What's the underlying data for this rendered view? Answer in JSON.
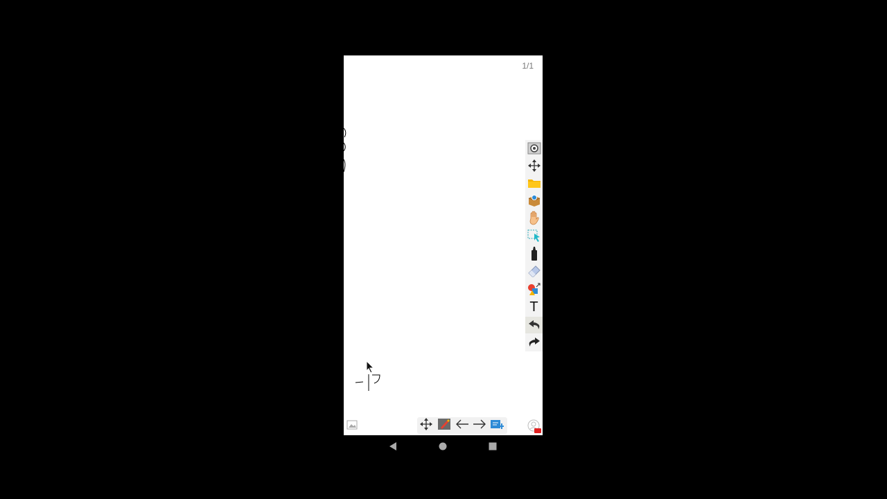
{
  "app": {
    "page_counter": "1/1"
  },
  "toolbar": {
    "items": [
      {
        "name": "settings",
        "icon": "gear-icon"
      },
      {
        "name": "move",
        "icon": "move-arrows-icon"
      },
      {
        "name": "open-folder",
        "icon": "folder-icon"
      },
      {
        "name": "insert-object",
        "icon": "package-icon"
      },
      {
        "name": "pan-hand",
        "icon": "hand-icon"
      },
      {
        "name": "select",
        "icon": "select-cursor-icon"
      },
      {
        "name": "pen",
        "icon": "marker-pen-icon"
      },
      {
        "name": "eraser",
        "icon": "eraser-icon"
      },
      {
        "name": "shapes",
        "icon": "shapes-icon"
      },
      {
        "name": "text",
        "icon": "text-icon",
        "label": "T"
      },
      {
        "name": "undo",
        "icon": "undo-icon"
      },
      {
        "name": "redo",
        "icon": "redo-icon"
      }
    ]
  },
  "bottom_bar": {
    "left_icon": "image-icon",
    "center": [
      "move-arrows-icon",
      "screen-draw-icon",
      "arrow-left-icon",
      "arrow-right-icon",
      "add-page-icon"
    ],
    "right_icon": "record-icon",
    "record_badge": "REC"
  },
  "android_nav": [
    "back-icon",
    "home-icon",
    "recents-icon"
  ],
  "colors": {
    "background": "#000000",
    "canvas": "#ffffff",
    "toolbar_bg": "#f3f3f3",
    "folder": "#f5b400",
    "accent_blue": "#2c8ad6",
    "record_red": "#e02020"
  }
}
